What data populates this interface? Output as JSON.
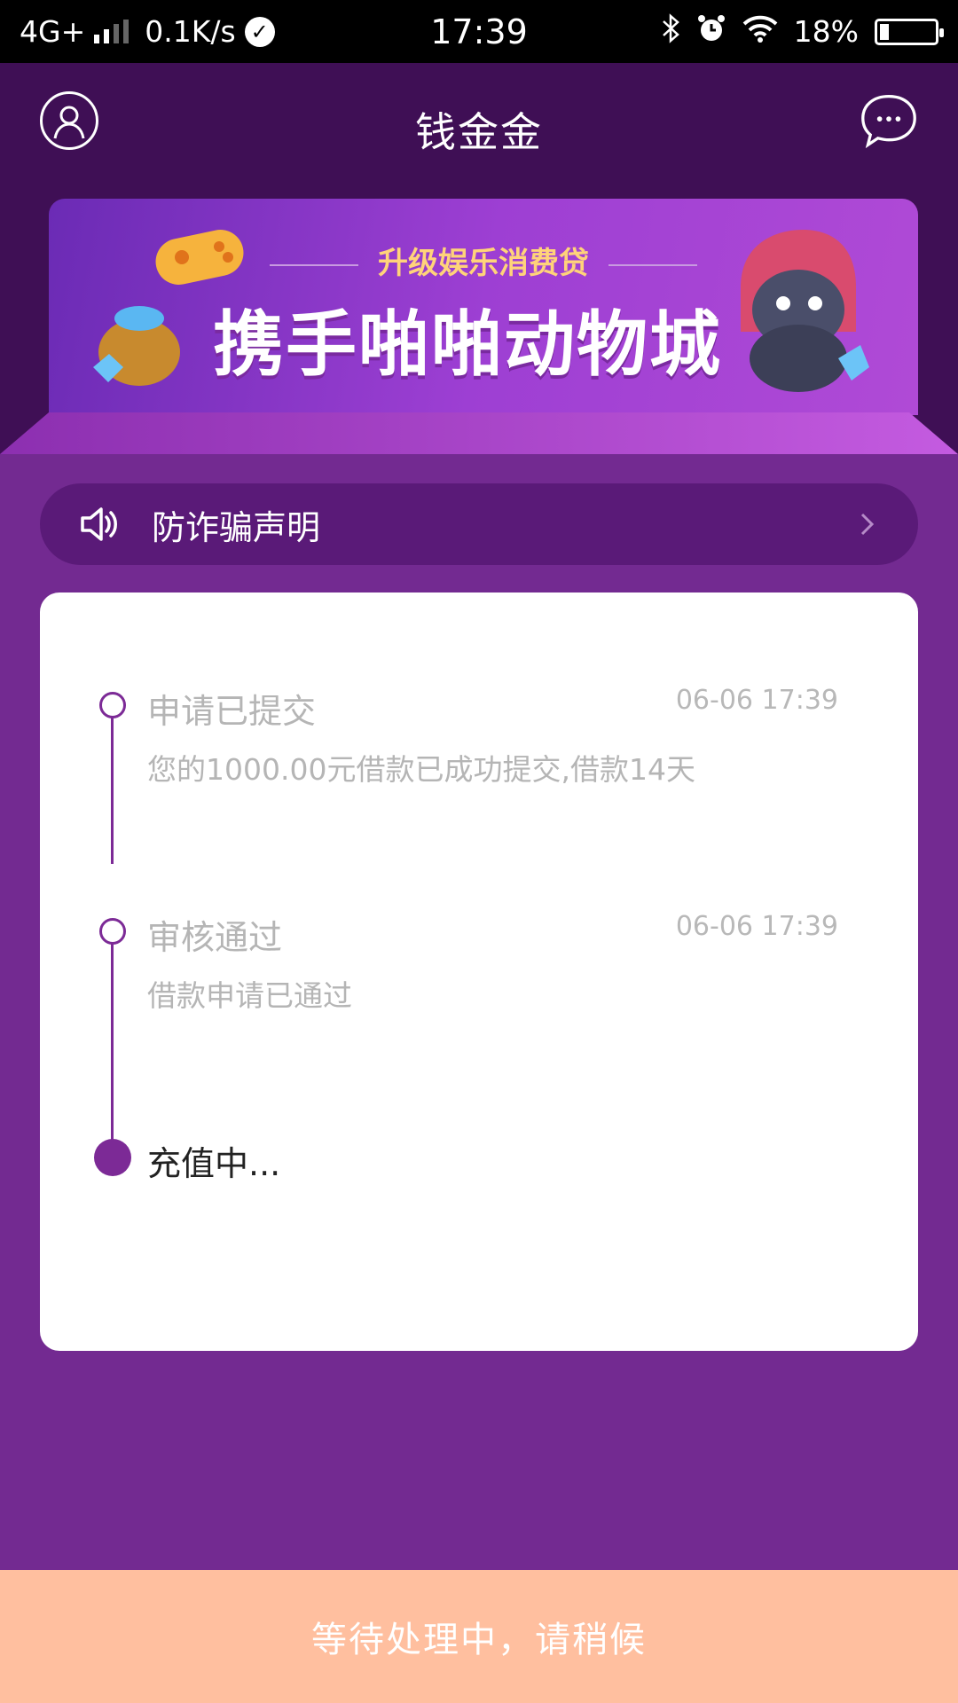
{
  "status_bar": {
    "network": "4G+",
    "speed": "0.1K/s",
    "time": "17:39",
    "battery": "18%"
  },
  "header": {
    "title": "钱金金",
    "profile_icon": "user-profile-icon",
    "message_icon": "chat-bubble-icon"
  },
  "banner": {
    "subtitle": "升级娱乐消费贷",
    "main_text": "携手啪啪动物城"
  },
  "notice": {
    "text": "防诈骗声明",
    "icon": "speaker-icon"
  },
  "timeline": {
    "steps": [
      {
        "title": "申请已提交",
        "time": "06-06 17:39",
        "desc": "您的1000.00元借款已成功提交,借款14天"
      },
      {
        "title": "审核通过",
        "time": "06-06 17:39",
        "desc": "借款申请已通过"
      },
      {
        "title": "充值中..."
      }
    ]
  },
  "bottom_button": {
    "label": "等待处理中，请稍候"
  },
  "colors": {
    "header_bg": "#3f0f55",
    "page_bg": "#732a91",
    "accent": "#7c2a96",
    "bottom_button_bg": "#ffbf9f"
  }
}
